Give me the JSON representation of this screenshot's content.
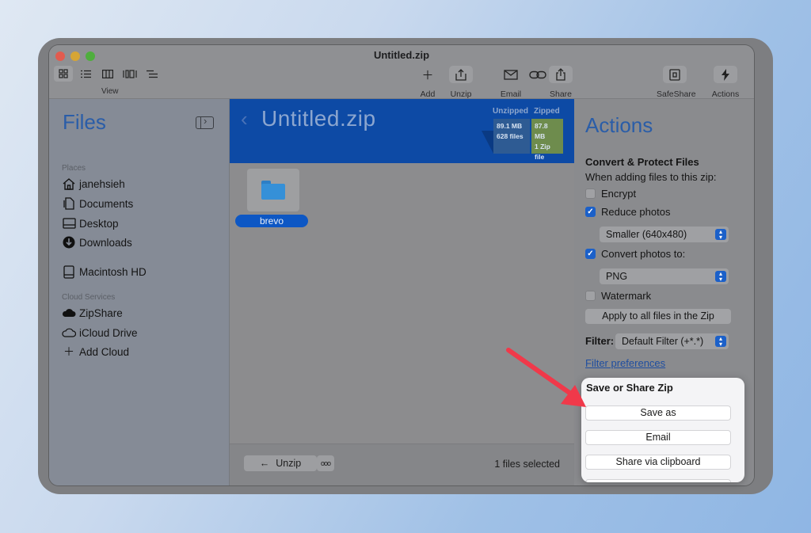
{
  "window": {
    "title": "Untitled.zip"
  },
  "toolbar": {
    "view_label": "View",
    "add_label": "Add",
    "unzip_label": "Unzip",
    "email_label": "Email",
    "share_label": "Share",
    "safeshare_label": "SafeShare",
    "actions_label": "Actions"
  },
  "sidebar": {
    "title": "Files",
    "places_label": "Places",
    "places": [
      "janehsieh",
      "Documents",
      "Desktop",
      "Downloads"
    ],
    "drive": "Macintosh HD",
    "cloud_label": "Cloud Services",
    "cloud": [
      "ZipShare",
      "iCloud Drive",
      "Add Cloud"
    ]
  },
  "main": {
    "zip_title": "Untitled.zip",
    "unzipped_head": "Unzipped",
    "zipped_head": "Zipped",
    "unzipped_size": "89.1 MB",
    "unzipped_files": "628 files",
    "zipped_size": "87.8 MB",
    "zipped_files": "1 Zip file",
    "file_name": "brevo",
    "unzip_button": "Unzip",
    "more_button": "ooo",
    "status": "1 files selected"
  },
  "actions": {
    "title": "Actions",
    "section_title": "Convert & Protect Files",
    "subtitle": "When adding files to this zip:",
    "encrypt": "Encrypt",
    "reduce_photos": "Reduce photos",
    "reduce_option": "Smaller (640x480)",
    "convert_photos": "Convert photos to:",
    "convert_option": "PNG",
    "watermark": "Watermark",
    "apply_button": "Apply to all files in the Zip",
    "filter_label": "Filter:",
    "filter_option": "Default Filter (+*.*)",
    "filter_link": "Filter preferences",
    "checkbox_states": {
      "encrypt": false,
      "reduce_photos": true,
      "convert_photos": true,
      "watermark": false
    }
  },
  "save_panel": {
    "title": "Save or Share Zip",
    "save_as": "Save as",
    "email": "Email",
    "clipboard": "Share via clipboard"
  },
  "colors": {
    "banner": "#0d4aa5",
    "accent": "#1b60c9",
    "annotation_arrow": "#f0394a"
  }
}
